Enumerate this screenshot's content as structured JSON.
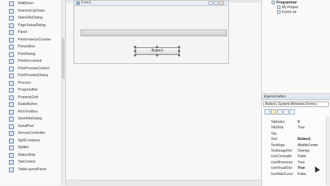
{
  "toolbox": {
    "items": [
      "NotifyIcon",
      "NumericUpDown",
      "OpenFileDialog",
      "PageSetupDialog",
      "Panel",
      "PerformanceCounter",
      "PictureBox",
      "PrintDialog",
      "PrintDocument",
      "PrintPreviewControl",
      "PrintPreviewDialog",
      "Process",
      "ProgressBar",
      "PropertyGrid",
      "RadioButton",
      "RichTextBox",
      "SaveFileDialog",
      "SerialPort",
      "ServiceController",
      "SplitContainer",
      "Splitter",
      "StatusStrip",
      "TabControl",
      "TableLayoutPanel"
    ]
  },
  "designer": {
    "form_title": "Form1",
    "button_label": "Button1"
  },
  "solution_explorer": {
    "items": [
      "Programmar",
      "My Project",
      "Form1.vb"
    ]
  },
  "properties": {
    "header": "Eigenschaften",
    "object_selector": "Button1  System.Windows.Forms.I",
    "rows": [
      {
        "name": "TabIndex",
        "value": "0",
        "bold": true
      },
      {
        "name": "TabStop",
        "value": "True",
        "bold": false
      },
      {
        "name": "Tag",
        "value": "",
        "bold": false
      },
      {
        "name": "Text",
        "value": "Button1",
        "bold": true
      },
      {
        "name": "TextAlign",
        "value": "MiddleCenter",
        "bold": false
      },
      {
        "name": "TextImageRel",
        "value": "Overlay",
        "bold": false
      },
      {
        "name": "UseCompatib",
        "value": "False",
        "bold": false
      },
      {
        "name": "UseMnemonic",
        "value": "True",
        "bold": false
      },
      {
        "name": "UseVisualStyl",
        "value": "True",
        "bold": true
      },
      {
        "name": "UseWaitCurso",
        "value": "False",
        "bold": false
      }
    ]
  }
}
